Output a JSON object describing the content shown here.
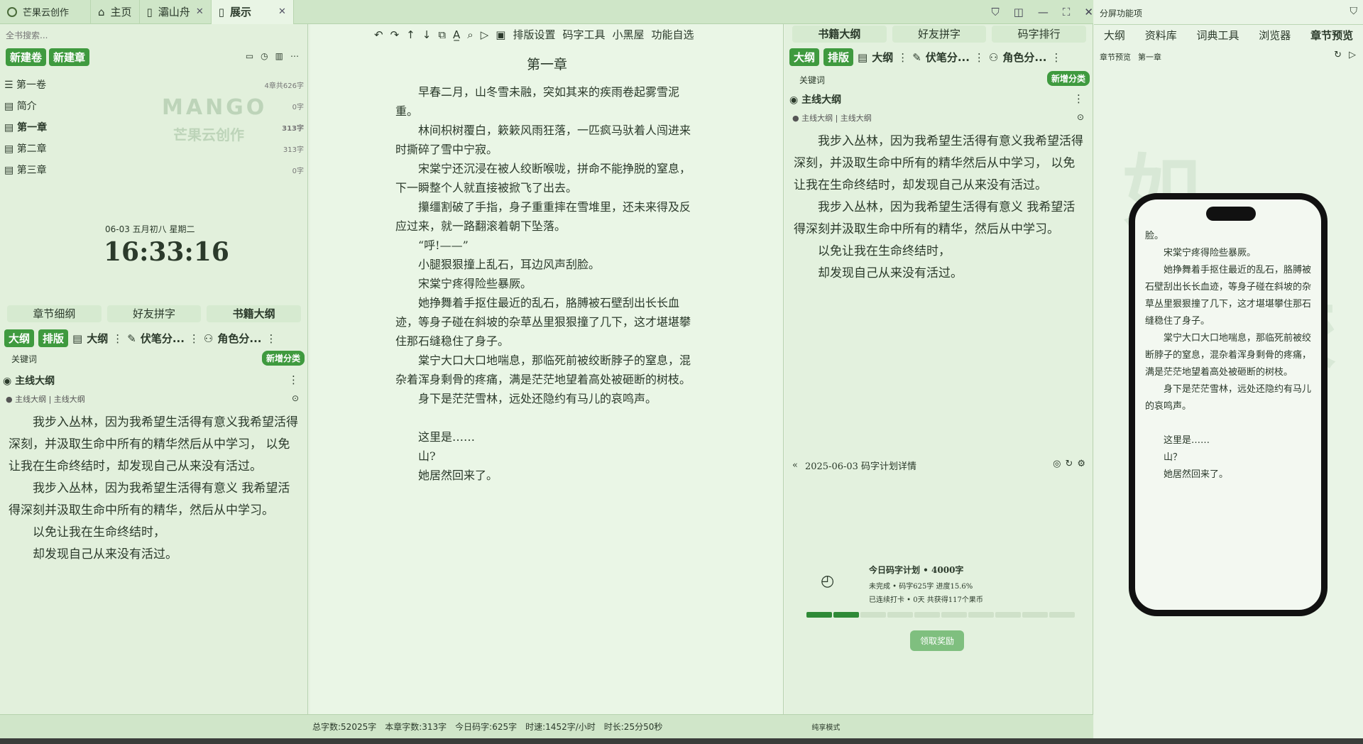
{
  "titlebar": {
    "app_name": "芒果云创作",
    "tabs": [
      {
        "label": "主页"
      },
      {
        "label": "灞山舟"
      },
      {
        "label": "展示"
      }
    ]
  },
  "right_panel": {
    "title": "分屏功能项",
    "tabs": [
      "大纲",
      "资料库",
      "词典工具",
      "浏览器",
      "章节预览"
    ],
    "breadcrumb": "章节预览",
    "chapter": "第一章",
    "phone_paragraphs": [
      "脸。",
      "宋棠宁疼得险些暴厥。",
      "她挣舞着手抠住最近的乱石，胳膊被石壁刮出长长血迹，等身子碰在斜坡的杂草丛里狠狠撞了几下，这才堪堪攀住那石缝稳住了身子。",
      "棠宁大口大口地喘息，那临死前被绞断脖子的窒息，混杂着浑身剩骨的疼痛，满是茫茫地望着高处被砸断的树枝。",
      "身下是茫茫雪林，远处还隐约有马儿的哀鸣声。",
      "",
      "这里是……",
      "山？",
      "她居然回来了。"
    ]
  },
  "left": {
    "search_placeholder": "全书搜索...",
    "new_volume": "新建卷",
    "new_chapter": "新建章",
    "chapters": [
      {
        "name": "第一卷",
        "wc": "4章共626字"
      },
      {
        "name": "简介",
        "wc": "0字"
      },
      {
        "name": "第一章",
        "wc": "313字"
      },
      {
        "name": "第二章",
        "wc": "313字"
      },
      {
        "name": "第三章",
        "wc": "0字"
      }
    ],
    "watermark": "MANGO",
    "watermark_sub": "芒果云创作",
    "date": "06-03  五月初八  星期二",
    "clock": "16:33:16",
    "bottom_tabs": [
      "章节细纲",
      "好友拼字",
      "书籍大纲"
    ],
    "toolbar": {
      "outline": "大纲",
      "layout": "排版",
      "big_outline": "大纲",
      "foreshadow": "伏笔分...",
      "role": "角色分..."
    },
    "keyword_label": "关键词",
    "add_category": "新增分类",
    "main_outline": "主线大纲",
    "outline_path": "主线大纲 | 主线大纲",
    "paragraphs": [
      "我步入丛林，因为我希望生活得有意义我希望活得深刻，并汲取生命中所有的精华然后从中学习，  以免让我在生命终结时，却发现自己从来没有活过。",
      "我步入丛林，因为我希望生活得有意义   我希望活得深刻并汲取生命中所有的精华，然后从中学习。",
      "以免让我在生命终结时，",
      "却发现自己从来没有活过。"
    ]
  },
  "editor": {
    "toolbar_items": [
      "排版设置",
      "码字工具",
      "小黑屋",
      "功能自选"
    ],
    "chapter_title": "第一章",
    "paragraphs": [
      "早春二月，山冬雪未融，突如其来的疾雨卷起雾雪泥重。",
      "林间枳树覆白，簌簌风雨狂落，一匹疯马驮着人闯进来时撕碎了雪中宁寂。",
      "宋棠宁还沉浸在被人绞断喉咙，拼命不能挣脱的窒息，下一瞬整个人就直接被掀飞了出去。",
      "攥缰割破了手指，身子重重摔在雪堆里，还未来得及反应过来，就一路翻滚着朝下坠落。",
      "“呼!——”",
      "小腿狠狠撞上乱石，耳边风声刮脸。",
      "宋棠宁疼得险些暴厥。",
      "她挣舞着手抠住最近的乱石，胳膊被石壁刮出长长血迹，等身子碰在斜坡的杂草丛里狠狠撞了几下，这才堪堪攀住那石缝稳住了身子。",
      "棠宁大口大口地喘息，那临死前被绞断脖子的窒息，混杂着浑身剩骨的疼痛，满是茫茫地望着高处被砸断的树枝。",
      "身下是茫茫雪林，远处还隐约有马儿的哀鸣声。",
      "",
      "这里是……",
      "山?",
      "她居然回来了。"
    ]
  },
  "mid": {
    "tabs": [
      "书籍大纲",
      "好友拼字",
      "码字排行"
    ],
    "toolbar": {
      "outline": "大纲",
      "layout": "排版",
      "big_outline": "大纲",
      "foreshadow": "伏笔分...",
      "role": "角色分..."
    },
    "keyword_label": "关键词",
    "add_category": "新增分类",
    "main_outline": "主线大纲",
    "outline_path": "主线大纲 | 主线大纲",
    "paragraphs": [
      "我步入丛林，因为我希望生活得有意义我希望活得深刻，并汲取生命中所有的精华然后从中学习，  以免让我在生命终结时，却发现自己从来没有活过。",
      "我步入丛林，因为我希望生活得有意义   我希望活得深刻并汲取生命中所有的精华，然后从中学习。",
      "以免让我在生命终结时，",
      "却发现自己从来没有活过。"
    ],
    "plan_header": "2025-06-03 码字计划详情",
    "plan_title": "今日码字计划  •  4000字",
    "plan_status": "未完成  •  码字625字  进度15.6%",
    "plan_streak": "已连续打卡  •  0天   共获得117个果币",
    "progress_percent": 15.6,
    "claim_button": "领取奖励"
  },
  "statusbar": {
    "total": "总字数:52025字",
    "chapter": "本章字数:313字",
    "today": "今日码字:625字",
    "speed": "时速:1452字/小时",
    "duration": "时长:25分50秒",
    "mode": "纯享模式"
  },
  "colors": {
    "accent": "#3f9a3f",
    "panel": "#e3f1de",
    "titlebar": "#cfe6c8"
  }
}
